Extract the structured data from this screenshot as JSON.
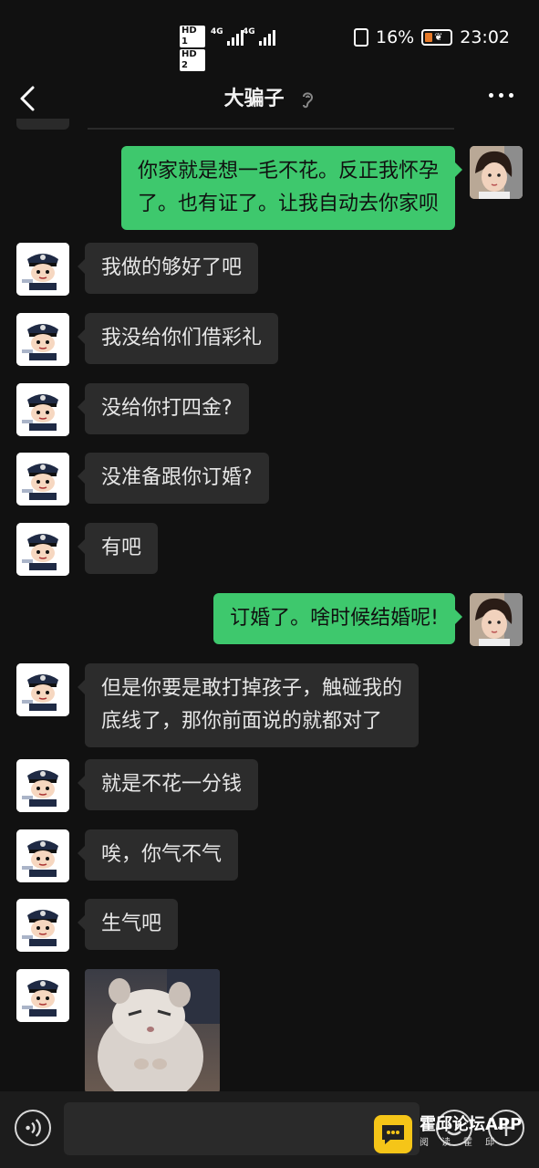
{
  "status_bar": {
    "hd1": "HD 1",
    "hd2": "HD 2",
    "net1": "4G",
    "net2": "4G",
    "battery_percent": "16%",
    "time": "23:02"
  },
  "header": {
    "title": "大骗子",
    "back_icon": "chevron-left-icon",
    "earpiece_icon": "ear-icon",
    "more_icon": "more-dots-icon"
  },
  "messages": [
    {
      "side": "out",
      "text": "你家就是想一毛不花。反正我怀孕\n了。也有证了。让我自动去你家呗"
    },
    {
      "side": "in",
      "text": "我做的够好了吧"
    },
    {
      "side": "in",
      "text": "我没给你们借彩礼"
    },
    {
      "side": "in",
      "text": "没给你打四金?"
    },
    {
      "side": "in",
      "text": "没准备跟你订婚?"
    },
    {
      "side": "in",
      "text": "有吧"
    },
    {
      "side": "out",
      "text": "订婚了。啥时候结婚呢!"
    },
    {
      "side": "in",
      "text": "但是你要是敢打掉孩子，触碰我的\n底线了，那你前面说的就都对了"
    },
    {
      "side": "in",
      "text": "就是不花一分钱"
    },
    {
      "side": "in",
      "text": "唉，你气不气"
    },
    {
      "side": "in",
      "text": "生气吧"
    },
    {
      "side": "in",
      "type": "sticker",
      "description": ""
    }
  ],
  "input_bar": {
    "voice_icon": "voice-icon",
    "emoji_icon": "emoji-icon",
    "plus_icon": "plus-icon"
  },
  "watermark": {
    "title": "霍邱论坛APP",
    "subtitle": "阅读霍邱"
  },
  "colors": {
    "background": "#111111",
    "incoming_bubble": "#2c2c2c",
    "outgoing_bubble": "#3ec86d",
    "watermark_logo": "#f5c518"
  }
}
